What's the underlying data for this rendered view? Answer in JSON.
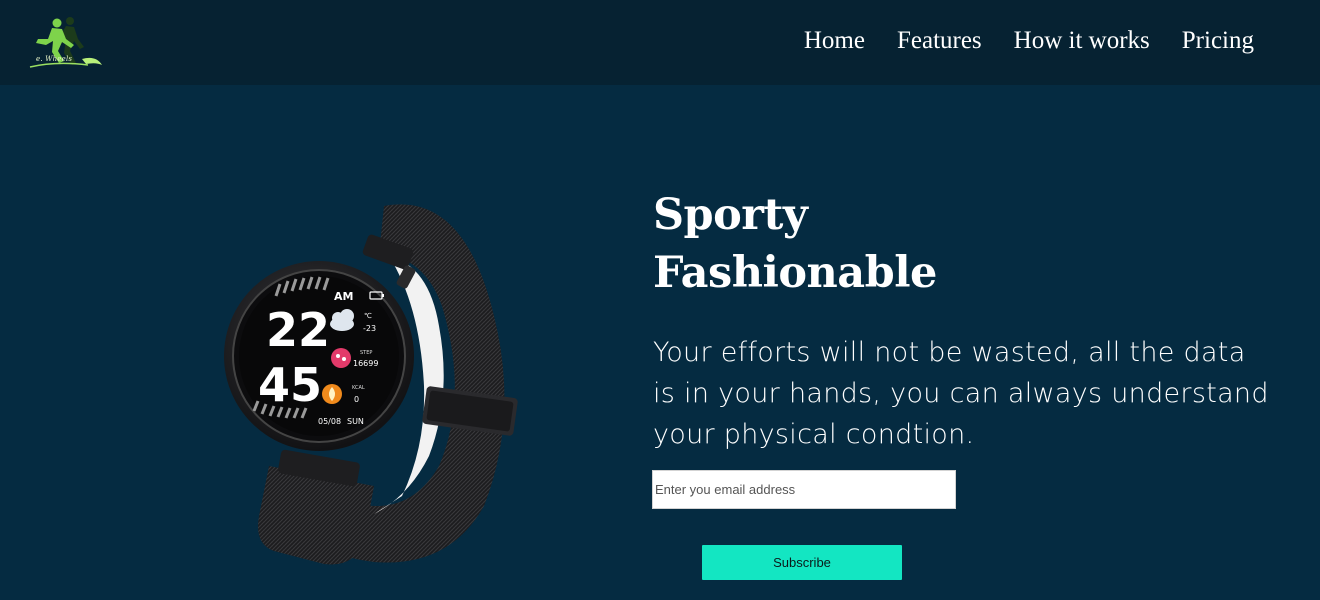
{
  "brand": {
    "logo_text": "e. Wheels"
  },
  "nav": {
    "items": [
      {
        "label": "Home"
      },
      {
        "label": "Features"
      },
      {
        "label": "How it works"
      },
      {
        "label": "Pricing"
      }
    ]
  },
  "hero": {
    "headline_line1": "Sporty",
    "headline_line2": "Fashionable",
    "tagline_line1": "Your efforts will not be wasted, all the data",
    "tagline_line2": "is in your hands, you can always understand",
    "tagline_line3": "your physical condtion.",
    "email_placeholder": "Enter you email address",
    "subscribe_label": "Subscribe"
  },
  "watch_face": {
    "time_hour": "22",
    "time_minute": "45",
    "ampm": "AM",
    "temp_unit": "℃",
    "temp_value": "-23",
    "step_label": "STEP",
    "step_value": "16699",
    "kcal_label": "KCAL",
    "kcal_value": "0",
    "date": "05/08",
    "weekday": "SUN"
  },
  "colors": {
    "page_background": "#052b41",
    "header_background": "#062232",
    "accent_button": "#13e6c2",
    "text": "#ffffff"
  },
  "icons": [
    "runner-logo-icon",
    "cloud-icon",
    "steps-icon",
    "flame-icon",
    "battery-icon"
  ]
}
